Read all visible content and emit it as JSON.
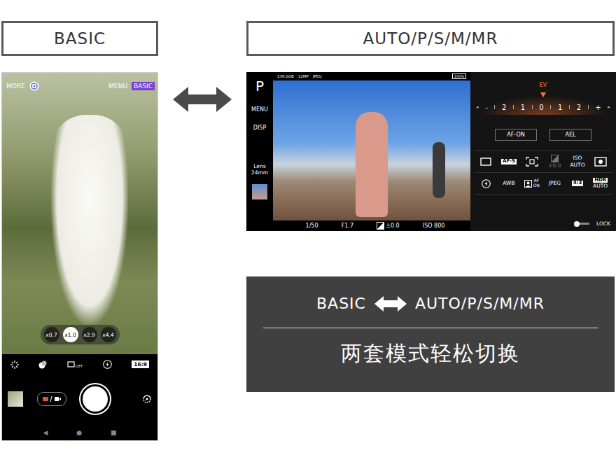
{
  "left_panel": {
    "label": "BASIC"
  },
  "phone": {
    "top_bar": {
      "more": "MORE",
      "menu": "MENU",
      "mode_badge": "BASIC"
    },
    "zoom": [
      {
        "label": "x0.7",
        "selected": false
      },
      {
        "label": "x1.0",
        "selected": true
      },
      {
        "label": "x2.9",
        "selected": false
      },
      {
        "label": "x4.4",
        "selected": false
      }
    ],
    "toolbar": {
      "timer_badge": "OFF",
      "aspect": "16:9"
    },
    "nav": [
      "◀",
      "●",
      "■"
    ]
  },
  "right_panel": {
    "label": "AUTO/P/S/M/MR"
  },
  "camera": {
    "mode": "P",
    "side_menu": [
      "MENU",
      "DISP"
    ],
    "lens": {
      "label": "Lens",
      "value": "24mm"
    },
    "status": [
      "236.0GB",
      "12MP",
      "JPEG"
    ],
    "battery": "100%",
    "readouts": [
      {
        "text": "1/50",
        "kind": "plain"
      },
      {
        "text": "F1.7",
        "kind": "plain"
      },
      {
        "text": "±0.0",
        "kind": "exposure"
      },
      {
        "text": "ISO 800",
        "kind": "plain"
      }
    ],
    "ev": {
      "label": "EV",
      "arrows": [
        "◂",
        "▸"
      ],
      "ticks": [
        "-",
        "2",
        "1",
        "0",
        "1",
        "2",
        "+"
      ],
      "level": 0.5
    },
    "buttons": [
      "AF-ON",
      "AEL"
    ],
    "grid": [
      {
        "kind": "icon",
        "lines": [],
        "disabled": false
      },
      {
        "kind": "badge",
        "lines": [
          "AF-S"
        ],
        "disabled": false
      },
      {
        "kind": "icon",
        "lines": [],
        "disabled": false
      },
      {
        "kind": "icontext",
        "lines": [
          "±0.0"
        ],
        "disabled": true
      },
      {
        "kind": "text",
        "lines": [
          "ISO",
          "AUTO"
        ],
        "disabled": false
      },
      {
        "kind": "icon",
        "lines": [],
        "disabled": false
      },
      {
        "kind": "icon",
        "lines": [],
        "disabled": false
      },
      {
        "kind": "text",
        "lines": [
          "AWB"
        ],
        "disabled": false
      },
      {
        "kind": "icontext",
        "lines": [
          "AF",
          "ON"
        ],
        "disabled": false
      },
      {
        "kind": "text",
        "lines": [
          "JPEG"
        ],
        "disabled": false
      },
      {
        "kind": "badge",
        "lines": [
          "4:3"
        ],
        "disabled": false
      },
      {
        "kind": "badge",
        "lines": [
          "HDR",
          "AUTO"
        ],
        "disabled": false
      }
    ],
    "lock": {
      "label": "LOCK",
      "on": false
    }
  },
  "caption": {
    "left": "BASIC",
    "right": "AUTO/P/S/M/MR",
    "subtitle": "两套模式轻松切换"
  }
}
